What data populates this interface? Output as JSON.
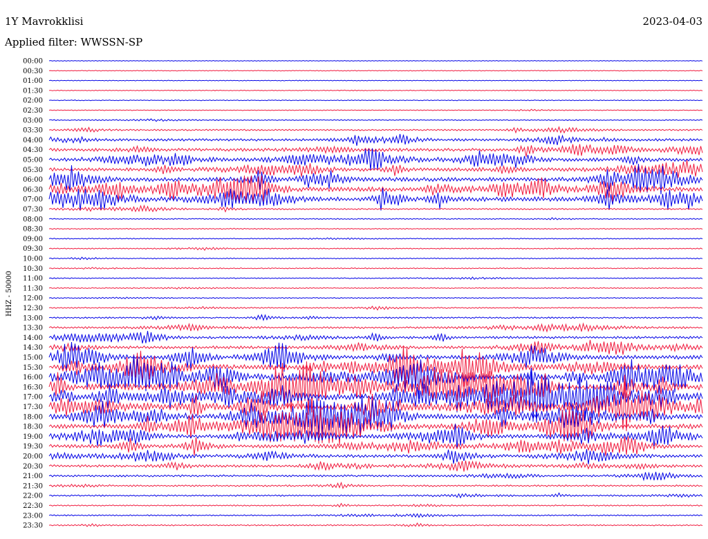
{
  "header": {
    "station": "1Y Mavrokklisi",
    "date": "2023-04-03",
    "filter": "Applied filter: WWSSN-SP"
  },
  "chart_data": {
    "type": "line",
    "title": "1Y Mavrokklisi",
    "ylabel": "HHZ - 50000",
    "colors": [
      "#0000e6",
      "#f0183c"
    ],
    "row_labels": [
      "00:00",
      "00:30",
      "01:00",
      "01:30",
      "02:00",
      "02:30",
      "03:00",
      "03:30",
      "04:00",
      "04:30",
      "05:00",
      "05:30",
      "06:00",
      "06:30",
      "07:00",
      "07:30",
      "08:00",
      "08:30",
      "09:00",
      "09:30",
      "10:00",
      "10:30",
      "11:00",
      "11:30",
      "12:00",
      "12:30",
      "13:00",
      "13:30",
      "14:00",
      "14:30",
      "15:00",
      "15:30",
      "16:00",
      "16:30",
      "17:00",
      "17:30",
      "18:00",
      "18:30",
      "19:00",
      "19:30",
      "20:00",
      "20:30",
      "21:00",
      "21:30",
      "22:00",
      "22:30",
      "23:00",
      "23:30"
    ],
    "noise_level": [
      0.5,
      0.5,
      0.6,
      0.6,
      0.6,
      0.7,
      1,
      2,
      4,
      5,
      6,
      6,
      7,
      8,
      8,
      2,
      1,
      1,
      1,
      1,
      1,
      1,
      1,
      1,
      1,
      1.5,
      2,
      3,
      4,
      5,
      7,
      9,
      10,
      11,
      11,
      11,
      10,
      9,
      7,
      6,
      5,
      4,
      3,
      2.5,
      2,
      1.5,
      1.5,
      1.5
    ]
  }
}
